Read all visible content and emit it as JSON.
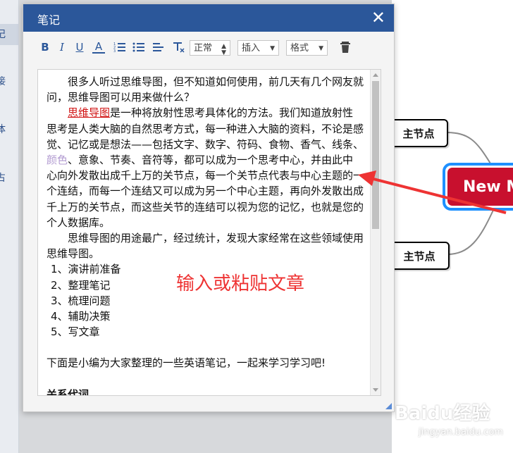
{
  "sidebar": {
    "items": [
      {
        "label": "记"
      },
      {
        "label": "接"
      },
      {
        "label": "体"
      },
      {
        "label": "占"
      }
    ]
  },
  "dialog": {
    "title": "笔记",
    "close_icon": "close-icon"
  },
  "toolbar": {
    "bold": "B",
    "italic": "I",
    "underline": "U",
    "font_color": "A",
    "format_select": "正常",
    "insert_select": "插入",
    "style_select": "格式"
  },
  "note": {
    "p1": "很多人听过思维导图，但不知道如何使用，前几天有几个网友就问，思维导图可以用来做什么？",
    "p2_link": "思维导图",
    "p2_a": "是一种将放射性思考具体化的方法。我们知道放射性思考是人类大脑的自然思考方式，每一种进入大脑的资料，不论是感觉、记忆或是想法——包括文字、数字、符码、食物、香气、线条、",
    "p2_purple": "颜色",
    "p2_b": "、意象、节奏、音符等，都可以成为一个思考中心，并由此中心向外发散出成千上万的关节点，每一个关节点代表与中心主题的一个连结，而每一个连结又可以成为另一个中心主题，再向外发散出成千上万的关节点，而这些关节的连结可以视为您的记忆，也就是您的个人数据库。",
    "p3": "思维导图的用途最广，经过统计，发现大家经常在这些领域使用思维导图。",
    "list": [
      "1、演讲前准备",
      "2、整理笔记",
      "3、梳理问题",
      "4、辅助决策",
      "5、写文章"
    ],
    "p4": "下面是小编为大家整理的一些英语笔记，一起来学习学习吧!",
    "p5_cut": "关系代词"
  },
  "annotation": "输入或粘贴文章",
  "mindmap": {
    "sub_node_top": "主节点",
    "sub_node_bottom": "主节点",
    "main_node": "New Mindmap"
  },
  "watermark": {
    "logo": "Baidu经验",
    "url": "jingyan.baidu.com"
  },
  "colors": {
    "header": "#2b579a",
    "main_node": "#c8102e",
    "main_node_border": "#1e90ff",
    "annotation": "#ee3333",
    "link": "#d01010"
  }
}
